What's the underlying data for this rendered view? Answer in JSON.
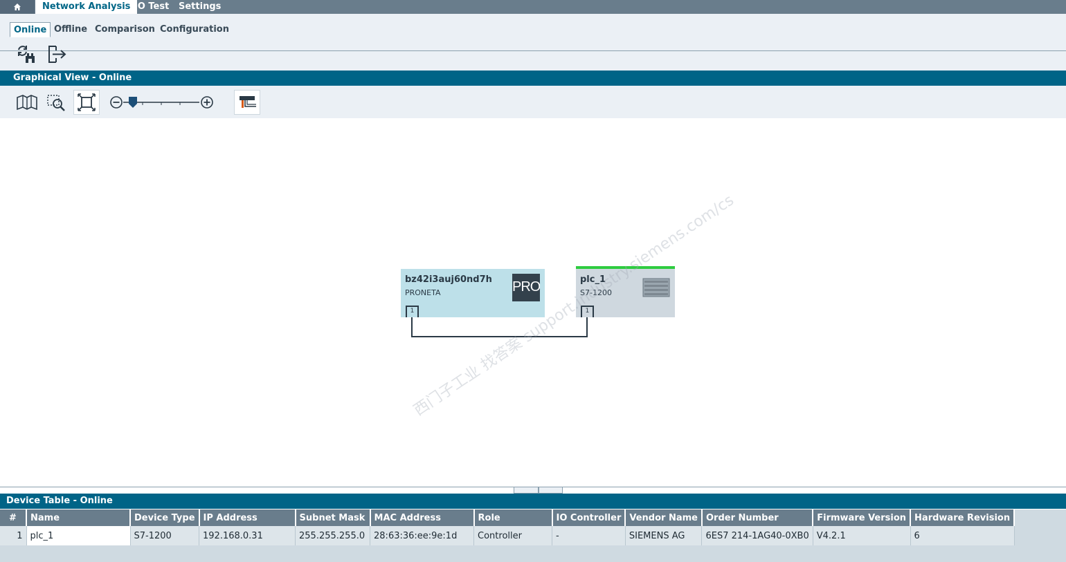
{
  "nav": {
    "home_icon": "home-icon",
    "tabs": [
      {
        "label": "Network Analysis",
        "active": true
      },
      {
        "label": "IO Test",
        "active": false
      },
      {
        "label": "Settings",
        "active": false
      }
    ]
  },
  "subtabs": [
    {
      "label": "Online",
      "active": true
    },
    {
      "label": "Offline",
      "active": false
    },
    {
      "label": "Comparison",
      "active": false
    },
    {
      "label": "Configuration",
      "active": false
    }
  ],
  "toolbar": {
    "icons": [
      "refresh-network-icon",
      "export-icon"
    ]
  },
  "graphical_view": {
    "title": "Graphical View - Online",
    "toolbar_icons": [
      "map-overview-icon",
      "zoom-area-icon",
      "fit-to-screen-icon",
      "zoom-out-icon",
      "zoom-in-icon",
      "topology-layout-icon"
    ],
    "zoom_level": 0.12
  },
  "devices": [
    {
      "name": "bz42i3auj60nd7h",
      "type": "PRONETA",
      "logo_text": "PRON",
      "port": "1",
      "color": "#bde0e9"
    },
    {
      "name": "plc_1",
      "type": "S7-1200",
      "port": "1",
      "color": "#cfd8df",
      "status_color": "#2ecc40"
    }
  ],
  "watermark": "西门子工业 找答案 support.industry.siemens.com/cs",
  "device_table": {
    "title": "Device Table - Online",
    "columns": [
      "#",
      "Name",
      "Device Type",
      "IP Address",
      "Subnet Mask",
      "MAC Address",
      "Role",
      "IO Controller",
      "Vendor Name",
      "Order Number",
      "Firmware Version",
      "Hardware Revision"
    ],
    "rows": [
      [
        "1",
        "plc_1",
        "S7-1200",
        "192.168.0.31",
        "255.255.255.0",
        "28:63:36:ee:9e:1d",
        "Controller",
        "-",
        "SIEMENS AG",
        "6ES7 214-1AG40-0XB0",
        "V4.2.1",
        "6"
      ]
    ]
  },
  "colors": {
    "header_bg": "#006487",
    "nav_bg": "#697d8c",
    "accent": "#006687"
  }
}
